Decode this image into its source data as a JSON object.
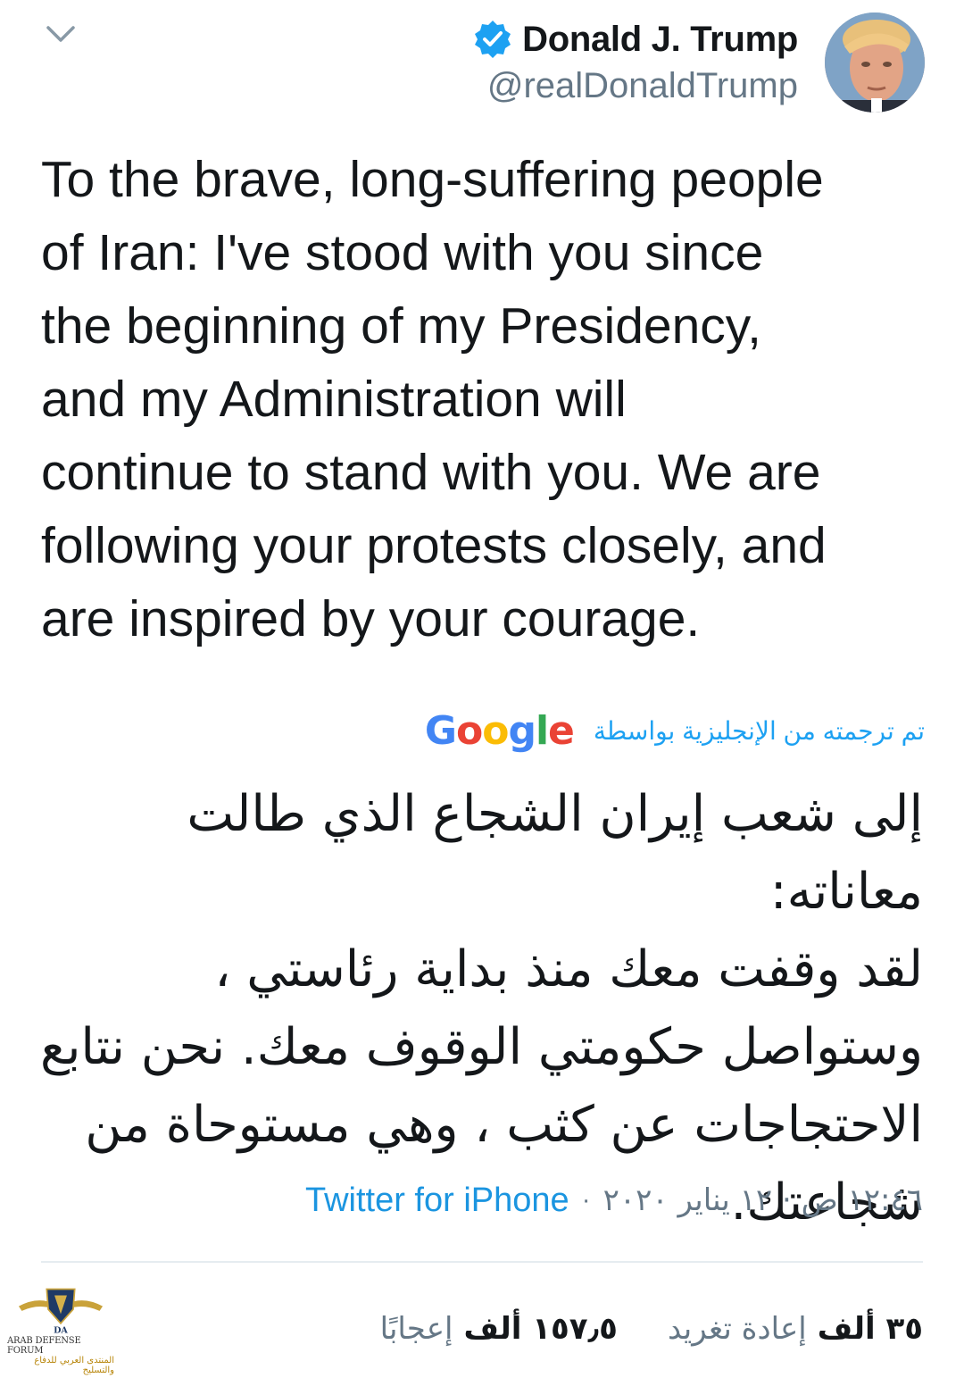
{
  "header": {
    "collapse_icon": "chevron-down-icon",
    "display_name": "Donald J. Trump",
    "handle": "@realDonaldTrump",
    "verified_icon": "verified-badge-icon",
    "avatar_icon": "profile-avatar"
  },
  "tweet": {
    "text": "To the brave, long-suffering people\nof Iran: I've stood with you since\nthe beginning of my Presidency,\nand my Administration will\ncontinue to stand with you. We are\nfollowing your protests closely, and\nare inspired by your courage."
  },
  "translation": {
    "label": "تم ترجمته من الإنجليزية بواسطة",
    "provider": "Google",
    "text": "إلى شعب إيران الشجاع الذي طالت معاناته:\nلقد وقفت معك منذ بداية رئاستي ،\nوستواصل حكومتي الوقوف معك. نحن نتابع\nالاحتجاجات عن كثب ، وهي مستوحاة من\nشجاعتك."
  },
  "meta": {
    "timestamp": "١٢:٤٦ ص · ١٢ يناير ٢٠٢٠",
    "separator": "·",
    "source": "Twitter for iPhone"
  },
  "stats": {
    "retweets_count": "٣٥ ألف",
    "retweets_label": "إعادة تغريد",
    "likes_count": "١٥٧٫٥ ألف",
    "likes_label": "إعجابًا"
  },
  "watermark": {
    "logo_letters": "DA",
    "line1": "ARAB DEFENSE FORUM",
    "line2": "المنتدى العربي للدفاع والتسليح"
  },
  "colors": {
    "link_blue": "#1da1f2",
    "source_blue": "#1b95e0",
    "muted_gray": "#657786",
    "text_dark": "#14171a"
  }
}
